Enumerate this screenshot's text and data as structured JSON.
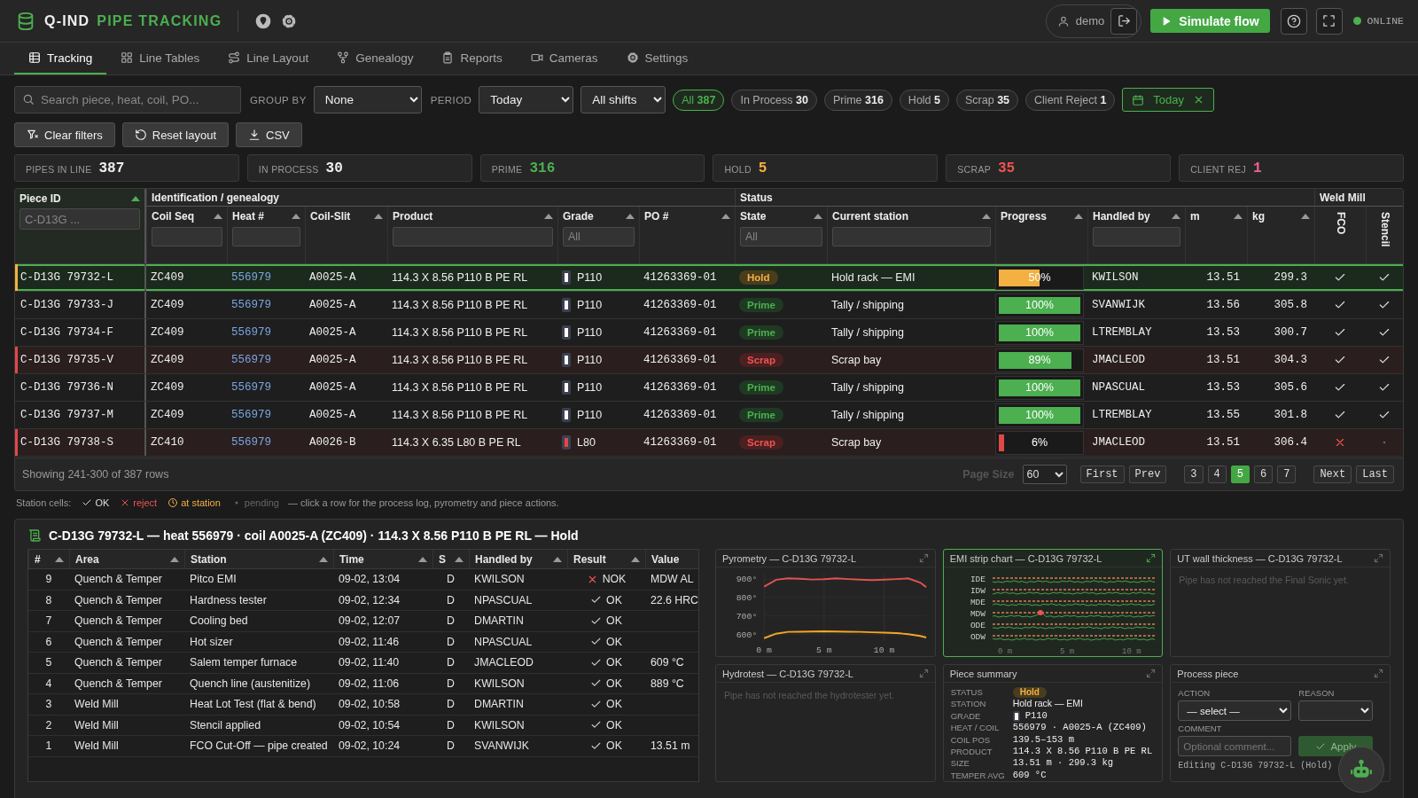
{
  "topbar": {
    "brand": {
      "name": "Q-IND",
      "product": "PIPE TRACKING"
    },
    "user": "demo",
    "simulate": "Simulate flow",
    "status": {
      "label": "ONLINE",
      "online": true
    }
  },
  "nav": [
    {
      "label": "Tracking",
      "selected": true
    },
    {
      "label": "Line Tables",
      "selected": false
    },
    {
      "label": "Line Layout",
      "selected": false
    },
    {
      "label": "Genealogy",
      "selected": false
    },
    {
      "label": "Reports",
      "selected": false
    },
    {
      "label": "Cameras",
      "selected": false
    },
    {
      "label": "Settings",
      "selected": false
    }
  ],
  "filters": {
    "search": {
      "placeholder": "Search piece, heat, coil, PO..."
    },
    "group_by": {
      "label": "GROUP BY",
      "value": "None"
    },
    "period": {
      "label": "PERIOD",
      "value": "Today"
    },
    "shift": {
      "value": "All shifts"
    },
    "chips": [
      {
        "label": "All",
        "count": "387",
        "selected": true
      },
      {
        "label": "In Process",
        "count": "30",
        "selected": false
      },
      {
        "label": "Prime",
        "count": "316",
        "selected": false
      },
      {
        "label": "Hold",
        "count": "5",
        "selected": false
      },
      {
        "label": "Scrap",
        "count": "35",
        "selected": false
      },
      {
        "label": "Client Reject",
        "count": "1",
        "selected": false
      }
    ],
    "date_filter": {
      "label": "Today"
    },
    "actions": [
      "Clear filters",
      "Reset layout",
      "CSV"
    ]
  },
  "kpis": [
    {
      "label": "PIPES IN LINE",
      "value": "387",
      "color": "#eeeeee"
    },
    {
      "label": "IN PROCESS",
      "value": "30",
      "color": "#eeeeee"
    },
    {
      "label": "PRIME",
      "value": "316",
      "color": "#4caf50"
    },
    {
      "label": "HOLD",
      "value": "5",
      "color": "#f5b042"
    },
    {
      "label": "SCRAP",
      "value": "35",
      "color": "#ef5350"
    },
    {
      "label": "CLIENT REJ",
      "value": "1",
      "color": "#f06292"
    }
  ],
  "table": {
    "piece_column": {
      "label": "Piece ID",
      "sorted": true,
      "filter": true,
      "filter_placeholder": "C-D13G ..."
    },
    "groups": [
      {
        "label": "Identification / genealogy",
        "columns": [
          {
            "label": "Coil Seq",
            "sorted": false,
            "filter": true
          },
          {
            "label": "Heat #",
            "sorted": false,
            "filter": true
          },
          {
            "label": "Coil-Slit",
            "sorted": false,
            "filter": false
          },
          {
            "label": "Product",
            "sorted": false,
            "filter": true
          },
          {
            "label": "Grade",
            "sorted": false,
            "filter": true,
            "filter_placeholder": "All"
          },
          {
            "label": "PO #",
            "sorted": false,
            "filter": false
          }
        ]
      },
      {
        "label": "Status",
        "columns": [
          {
            "label": "State",
            "sorted": false,
            "filter": true,
            "filter_placeholder": "All"
          },
          {
            "label": "Current station",
            "sorted": false,
            "filter": true
          },
          {
            "label": "Progress",
            "sorted": false,
            "filter": false
          },
          {
            "label": "Handled by",
            "sorted": false,
            "filter": true
          },
          {
            "label": "m",
            "sorted": false,
            "filter": false
          },
          {
            "label": "kg",
            "sorted": false,
            "filter": false
          }
        ]
      },
      {
        "label": "Weld Mill",
        "columns": [
          {
            "label": "FCO",
            "kind": "check",
            "filter": false
          },
          {
            "label": "Stencil",
            "kind": "check",
            "filter": false
          }
        ]
      }
    ],
    "rows": [
      {
        "piece_id": "C-D13G 79732-L",
        "coil_seq": "ZC409",
        "heat": "556979",
        "coil_slit": "A0025-A",
        "product": "114.3 X 8.56 P110 B PE RL",
        "grade": {
          "label": "P110",
          "color": "#ffffff"
        },
        "po": "41263369-01",
        "state": {
          "label": "Hold",
          "kind": "hold"
        },
        "station": "Hold rack — EMI",
        "progress": {
          "level": 0.5,
          "reading": "50%",
          "color": "#f5b042"
        },
        "handled_by": "KWILSON",
        "m": "13.51",
        "kg": "299.3",
        "fco": {
          "kind": "ok"
        },
        "stencil": {
          "kind": "ok"
        },
        "selected": true
      },
      {
        "piece_id": "C-D13G 79733-J",
        "coil_seq": "ZC409",
        "heat": "556979",
        "coil_slit": "A0025-A",
        "product": "114.3 X 8.56 P110 B PE RL",
        "grade": {
          "label": "P110",
          "color": "#ffffff"
        },
        "po": "41263369-01",
        "state": {
          "label": "Prime",
          "kind": "prime"
        },
        "station": "Tally / shipping",
        "progress": {
          "level": 1,
          "reading": "100%",
          "color": "#4caf50"
        },
        "handled_by": "SVANWIJK",
        "m": "13.56",
        "kg": "305.8",
        "fco": {
          "kind": "ok"
        },
        "stencil": {
          "kind": "ok"
        },
        "selected": false
      },
      {
        "piece_id": "C-D13G 79734-F",
        "coil_seq": "ZC409",
        "heat": "556979",
        "coil_slit": "A0025-A",
        "product": "114.3 X 8.56 P110 B PE RL",
        "grade": {
          "label": "P110",
          "color": "#ffffff"
        },
        "po": "41263369-01",
        "state": {
          "label": "Prime",
          "kind": "prime"
        },
        "station": "Tally / shipping",
        "progress": {
          "level": 1,
          "reading": "100%",
          "color": "#4caf50"
        },
        "handled_by": "LTREMBLAY",
        "m": "13.53",
        "kg": "300.7",
        "fco": {
          "kind": "ok"
        },
        "stencil": {
          "kind": "ok"
        },
        "selected": false
      },
      {
        "piece_id": "C-D13G 79735-V",
        "coil_seq": "ZC409",
        "heat": "556979",
        "coil_slit": "A0025-A",
        "product": "114.3 X 8.56 P110 B PE RL",
        "grade": {
          "label": "P110",
          "color": "#ffffff"
        },
        "po": "41263369-01",
        "state": {
          "label": "Scrap",
          "kind": "scrap"
        },
        "station": "Scrap bay",
        "progress": {
          "level": 0.89,
          "reading": "89%",
          "color": "#4caf50"
        },
        "handled_by": "JMACLEOD",
        "m": "13.51",
        "kg": "304.3",
        "fco": {
          "kind": "ok"
        },
        "stencil": {
          "kind": "ok"
        },
        "selected": false
      },
      {
        "piece_id": "C-D13G 79736-N",
        "coil_seq": "ZC409",
        "heat": "556979",
        "coil_slit": "A0025-A",
        "product": "114.3 X 8.56 P110 B PE RL",
        "grade": {
          "label": "P110",
          "color": "#ffffff"
        },
        "po": "41263369-01",
        "state": {
          "label": "Prime",
          "kind": "prime"
        },
        "station": "Tally / shipping",
        "progress": {
          "level": 1,
          "reading": "100%",
          "color": "#4caf50"
        },
        "handled_by": "NPASCUAL",
        "m": "13.53",
        "kg": "305.6",
        "fco": {
          "kind": "ok"
        },
        "stencil": {
          "kind": "ok"
        },
        "selected": false
      },
      {
        "piece_id": "C-D13G 79737-M",
        "coil_seq": "ZC409",
        "heat": "556979",
        "coil_slit": "A0025-A",
        "product": "114.3 X 8.56 P110 B PE RL",
        "grade": {
          "label": "P110",
          "color": "#ffffff"
        },
        "po": "41263369-01",
        "state": {
          "label": "Prime",
          "kind": "prime"
        },
        "station": "Tally / shipping",
        "progress": {
          "level": 1,
          "reading": "100%",
          "color": "#4caf50"
        },
        "handled_by": "LTREMBLAY",
        "m": "13.55",
        "kg": "301.8",
        "fco": {
          "kind": "ok"
        },
        "stencil": {
          "kind": "ok"
        },
        "selected": false
      },
      {
        "piece_id": "C-D13G 79738-S",
        "coil_seq": "ZC410",
        "heat": "556979",
        "coil_slit": "A0026-B",
        "product": "114.3 X 6.35 L80 B PE RL",
        "grade": {
          "label": "L80",
          "color": "#e04848"
        },
        "po": "41263369-01",
        "state": {
          "label": "Scrap",
          "kind": "scrap"
        },
        "station": "Scrap bay",
        "progress": {
          "level": 0.06,
          "reading": "6%",
          "color": "#e04848"
        },
        "handled_by": "JMACLEOD",
        "m": "13.51",
        "kg": "306.4",
        "fco": {
          "kind": "reject"
        },
        "stencil": {
          "kind": "pending"
        },
        "selected": false
      }
    ],
    "footer": {
      "showing": "Showing 241-300 of 387 rows",
      "page_size_label": "Page Size",
      "page_size": "60",
      "first": "First",
      "prev": "Prev",
      "pages": [
        {
          "label": "3",
          "selected": false
        },
        {
          "label": "4",
          "selected": false
        },
        {
          "label": "5",
          "selected": true
        },
        {
          "label": "6",
          "selected": false
        },
        {
          "label": "7",
          "selected": false
        }
      ],
      "next": "Next",
      "last": "Last"
    }
  },
  "legend": {
    "label": "Station cells:",
    "items": [
      {
        "kind": "ok",
        "label": "OK"
      },
      {
        "kind": "reject",
        "label": "reject"
      },
      {
        "kind": "at_station",
        "label": "at station"
      },
      {
        "kind": "pending",
        "label": "pending"
      }
    ],
    "hint": "— click a row for the process log, pyrometry and piece actions."
  },
  "detail": {
    "title": "C-D13G 79732-L — heat 556979 · coil A0025-A (ZC409) · 114.3 X 8.56 P110 B PE RL — Hold",
    "log": {
      "columns": [
        {
          "label": "#",
          "sorted": false
        },
        {
          "label": "Area",
          "sorted": false
        },
        {
          "label": "Station",
          "sorted": false
        },
        {
          "label": "Time",
          "sorted": false
        },
        {
          "label": "S",
          "sorted": false
        },
        {
          "label": "Handled by",
          "sorted": false
        },
        {
          "label": "Result",
          "sorted": false
        },
        {
          "label": "Value"
        }
      ],
      "rows": [
        {
          "n": "9",
          "area": "Quench & Temper",
          "station": "Pitco EMI",
          "time": "09-02, 13:04",
          "s": "D",
          "handled_by": "KWILSON",
          "result": {
            "kind": "nok",
            "label": "NOK"
          },
          "value": "MDW AL"
        },
        {
          "n": "8",
          "area": "Quench & Temper",
          "station": "Hardness tester",
          "time": "09-02, 12:34",
          "s": "D",
          "handled_by": "NPASCUAL",
          "result": {
            "kind": "ok",
            "label": "OK"
          },
          "value": "22.6 HRC"
        },
        {
          "n": "7",
          "area": "Quench & Temper",
          "station": "Cooling bed",
          "time": "09-02, 12:07",
          "s": "D",
          "handled_by": "DMARTIN",
          "result": {
            "kind": "ok",
            "label": "OK"
          }
        },
        {
          "n": "6",
          "area": "Quench & Temper",
          "station": "Hot sizer",
          "time": "09-02, 11:46",
          "s": "D",
          "handled_by": "NPASCUAL",
          "result": {
            "kind": "ok",
            "label": "OK"
          }
        },
        {
          "n": "5",
          "area": "Quench & Temper",
          "station": "Salem temper furnace",
          "time": "09-02, 11:40",
          "s": "D",
          "handled_by": "JMACLEOD",
          "result": {
            "kind": "ok",
            "label": "OK"
          },
          "value": "609 °C"
        },
        {
          "n": "4",
          "area": "Quench & Temper",
          "station": "Quench line (austenitize)",
          "time": "09-02, 11:06",
          "s": "D",
          "handled_by": "KWILSON",
          "result": {
            "kind": "ok",
            "label": "OK"
          },
          "value": "889 °C"
        },
        {
          "n": "3",
          "area": "Weld Mill",
          "station": "Heat Lot Test (flat & bend)",
          "time": "09-02, 10:58",
          "s": "D",
          "handled_by": "DMARTIN",
          "result": {
            "kind": "ok",
            "label": "OK"
          }
        },
        {
          "n": "2",
          "area": "Weld Mill",
          "station": "Stencil applied",
          "time": "09-02, 10:54",
          "s": "D",
          "handled_by": "KWILSON",
          "result": {
            "kind": "ok",
            "label": "OK"
          }
        },
        {
          "n": "1",
          "area": "Weld Mill",
          "station": "FCO Cut-Off — pipe created",
          "time": "09-02, 10:24",
          "s": "D",
          "handled_by": "SVANWIJK",
          "result": {
            "kind": "ok",
            "label": "OK"
          },
          "value": "13.51 m"
        }
      ]
    },
    "panels": [
      {
        "kind": "pyrometry",
        "title": "Pyrometry — C-D13G 79732-L",
        "active": false,
        "chart_data": {
          "type": "line",
          "x": [
            0,
            1,
            2,
            3,
            4,
            5,
            6,
            7,
            8,
            9,
            10,
            11,
            12,
            13,
            13.5
          ],
          "series": [
            {
              "color": "#e05252",
              "values": [
                858,
                896,
                904,
                901,
                897,
                898,
                903,
                899,
                896,
                894,
                896,
                899,
                903,
                880,
                856
              ]
            },
            {
              "color": "#f5a623",
              "values": [
                578,
                602,
                612,
                613,
                614,
                615,
                614,
                613,
                612,
                610,
                608,
                606,
                600,
                590,
                582
              ]
            }
          ],
          "grid": true,
          "xlim": [
            0,
            13.5
          ],
          "ylim": [
            560,
            930
          ],
          "xticks": [
            {
              "value": 0,
              "label": "0 m"
            },
            {
              "value": 5,
              "label": "5 m"
            },
            {
              "value": 10,
              "label": "10 m"
            }
          ],
          "yticks": [
            {
              "value": 600,
              "label": "600°"
            },
            {
              "value": 700,
              "label": "700°"
            },
            {
              "value": 800,
              "label": "800°"
            },
            {
              "value": 900,
              "label": "900°"
            }
          ]
        }
      },
      {
        "kind": "emi",
        "title": "EMI strip chart — C-D13G 79732-L",
        "active": true,
        "channels": [
          {
            "label": "IDE",
            "alarm": false
          },
          {
            "label": "IDW",
            "alarm": false
          },
          {
            "label": "MDE",
            "alarm": false
          },
          {
            "label": "MDW",
            "alarm": true
          },
          {
            "label": "ODE",
            "alarm": false
          },
          {
            "label": "ODW",
            "alarm": false
          }
        ],
        "xticks": [
          "0 m",
          "5 m",
          "10 m"
        ]
      },
      {
        "kind": "empty",
        "title": "UT wall thickness — C-D13G 79732-L",
        "active": false,
        "message": "Pipe has not reached the Final Sonic yet."
      },
      {
        "kind": "empty",
        "title": "Hydrotest — C-D13G 79732-L",
        "active": false,
        "message": "Pipe has not reached the hydrotester yet."
      },
      {
        "kind": "summary",
        "title": "Piece summary",
        "active": false,
        "fields": [
          {
            "label": "STATUS",
            "kind": "badge",
            "value": "Hold",
            "badge": {
              "kind": "hold"
            }
          },
          {
            "label": "STATION",
            "kind": "text",
            "value": "Hold rack — EMI"
          },
          {
            "label": "GRADE",
            "kind": "grade",
            "value": "P110",
            "color": "#ffffff"
          },
          {
            "label": "HEAT / COIL",
            "kind": "mono",
            "value": "556979 · A0025-A (ZC409)"
          },
          {
            "label": "COIL POS",
            "kind": "mono",
            "value": "139.5–153 m"
          },
          {
            "label": "PRODUCT",
            "kind": "mono",
            "value": "114.3 X 8.56 P110 B PE RL"
          },
          {
            "label": "SIZE",
            "kind": "mono",
            "value": "13.51 m · 299.3 kg"
          },
          {
            "label": "TEMPER AVG",
            "kind": "mono",
            "value": "609 °C"
          }
        ]
      },
      {
        "kind": "process",
        "title": "Process piece",
        "active": false,
        "action": {
          "label": "ACTION",
          "value": "— select —"
        },
        "reason": {
          "label": "REASON"
        },
        "comment": {
          "label": "COMMENT",
          "placeholder": "Optional comment..."
        },
        "apply": {
          "label": "Apply",
          "disabled": true
        },
        "note": "Editing C-D13G 79732-L (Hold)"
      }
    ]
  }
}
